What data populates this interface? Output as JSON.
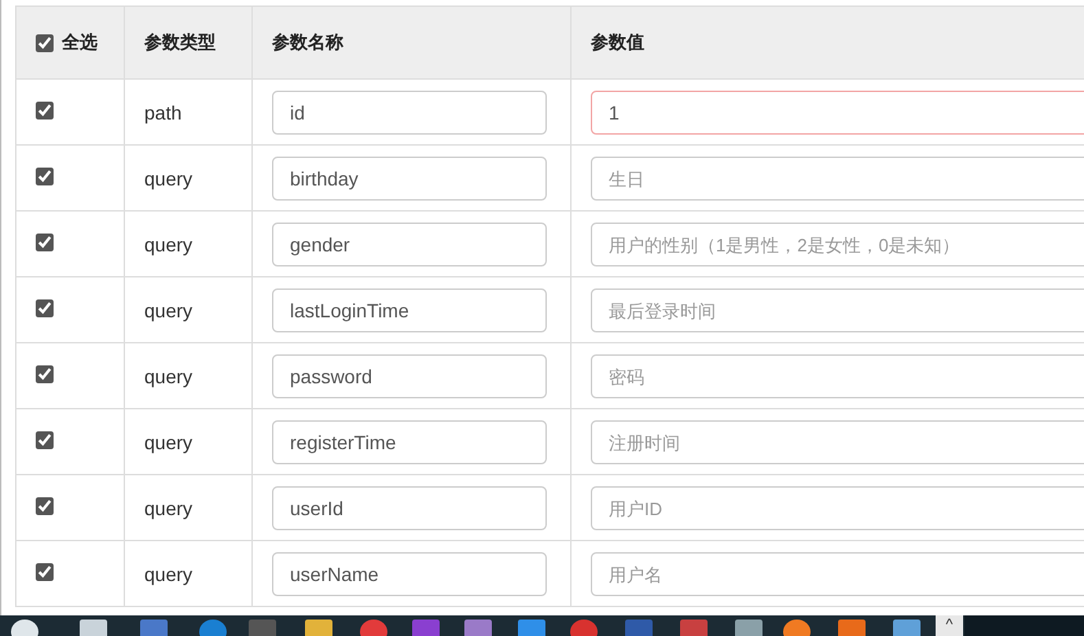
{
  "table": {
    "select_all": {
      "label": "全选",
      "checked": true
    },
    "columns": [
      "参数类型",
      "参数名称",
      "参数值"
    ],
    "rows": [
      {
        "checked": true,
        "type": "path",
        "name": "id",
        "value": "1",
        "invalid": true
      },
      {
        "checked": true,
        "type": "query",
        "name": "birthday",
        "placeholder": "生日",
        "invalid": false
      },
      {
        "checked": true,
        "type": "query",
        "name": "gender",
        "placeholder": "用户的性别（1是男性，2是女性，0是未知）",
        "invalid": false
      },
      {
        "checked": true,
        "type": "query",
        "name": "lastLoginTime",
        "placeholder": "最后登录时间",
        "invalid": false
      },
      {
        "checked": true,
        "type": "query",
        "name": "password",
        "placeholder": "密码",
        "invalid": false
      },
      {
        "checked": true,
        "type": "query",
        "name": "registerTime",
        "placeholder": "注册时间",
        "invalid": false
      },
      {
        "checked": true,
        "type": "query",
        "name": "userId",
        "placeholder": "用户ID",
        "invalid": false
      },
      {
        "checked": true,
        "type": "query",
        "name": "userName",
        "placeholder": "用户名",
        "invalid": false
      }
    ]
  },
  "taskbar": {
    "overflow_button": "^"
  }
}
